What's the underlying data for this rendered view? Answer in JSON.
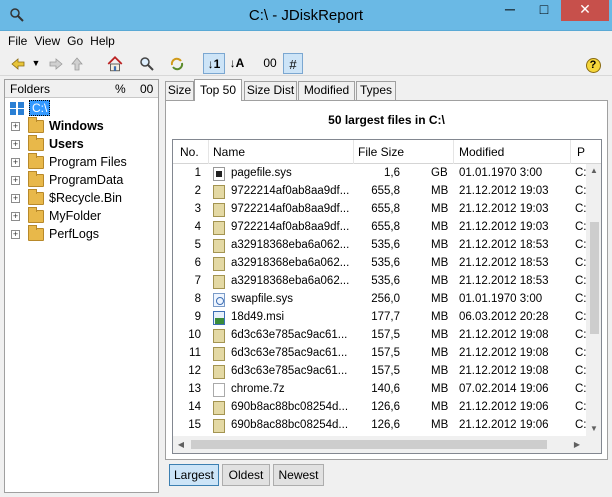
{
  "window": {
    "title": "C:\\ - JDiskReport",
    "minimize_glyph": "─",
    "maximize_glyph": "□",
    "close_glyph": "✕"
  },
  "menu": [
    "File",
    "View",
    "Go",
    "Help"
  ],
  "toolbar": {
    "back_icon": "arrow-left-icon",
    "forward_icon": "arrow-right-icon",
    "up_icon": "arrow-up-icon",
    "home_icon": "home-icon",
    "search_icon": "magnifier-icon",
    "refresh_icon": "refresh-icon",
    "sort_size_label": "↓1",
    "sort_name_label": "↓A",
    "show_size_label": "00",
    "show_count_label": "#",
    "help_label": "?"
  },
  "folders_panel": {
    "header": "Folders",
    "pct_label": "%",
    "count_label": "00",
    "root": "C:\\",
    "items": [
      {
        "name": "Windows",
        "bold": true
      },
      {
        "name": "Users",
        "bold": true
      },
      {
        "name": "Program Files",
        "bold": false
      },
      {
        "name": "ProgramData",
        "bold": false
      },
      {
        "name": "$Recycle.Bin",
        "bold": false
      },
      {
        "name": "MyFolder",
        "bold": false
      },
      {
        "name": "PerfLogs",
        "bold": false
      }
    ]
  },
  "tabs": [
    {
      "label": "Size",
      "active": false
    },
    {
      "label": "Top 50",
      "active": true
    },
    {
      "label": "Size Dist",
      "active": false
    },
    {
      "label": "Modified",
      "active": false
    },
    {
      "label": "Types",
      "active": false
    }
  ],
  "content": {
    "caption": "50 largest files in C:\\",
    "columns": [
      "No.",
      "Name",
      "File Size",
      "Modified",
      "P"
    ],
    "rows": [
      {
        "no": "1",
        "icon": "sys",
        "name": "pagefile.sys",
        "size": "1,6",
        "unit": "GB",
        "modified": "01.01.1970 3:00",
        "extra": "C:"
      },
      {
        "no": "2",
        "icon": "db",
        "name": "9722214af0ab8aa9df...",
        "size": "655,8",
        "unit": "MB",
        "modified": "21.12.2012 19:03",
        "extra": "C:"
      },
      {
        "no": "3",
        "icon": "db",
        "name": "9722214af0ab8aa9df...",
        "size": "655,8",
        "unit": "MB",
        "modified": "21.12.2012 19:03",
        "extra": "C:"
      },
      {
        "no": "4",
        "icon": "db",
        "name": "9722214af0ab8aa9df...",
        "size": "655,8",
        "unit": "MB",
        "modified": "21.12.2012 19:03",
        "extra": "C:"
      },
      {
        "no": "5",
        "icon": "db",
        "name": "a32918368eba6a062...",
        "size": "535,6",
        "unit": "MB",
        "modified": "21.12.2012 18:53",
        "extra": "C:"
      },
      {
        "no": "6",
        "icon": "db",
        "name": "a32918368eba6a062...",
        "size": "535,6",
        "unit": "MB",
        "modified": "21.12.2012 18:53",
        "extra": "C:"
      },
      {
        "no": "7",
        "icon": "db",
        "name": "a32918368eba6a062...",
        "size": "535,6",
        "unit": "MB",
        "modified": "21.12.2012 18:53",
        "extra": "C:"
      },
      {
        "no": "8",
        "icon": "swap",
        "name": "swapfile.sys",
        "size": "256,0",
        "unit": "MB",
        "modified": "01.01.1970 3:00",
        "extra": "C:"
      },
      {
        "no": "9",
        "icon": "msi",
        "name": "18d49.msi",
        "size": "177,7",
        "unit": "MB",
        "modified": "06.03.2012 20:28",
        "extra": "C:"
      },
      {
        "no": "10",
        "icon": "db",
        "name": "6d3c63e785ac9ac61...",
        "size": "157,5",
        "unit": "MB",
        "modified": "21.12.2012 19:08",
        "extra": "C:"
      },
      {
        "no": "11",
        "icon": "db",
        "name": "6d3c63e785ac9ac61...",
        "size": "157,5",
        "unit": "MB",
        "modified": "21.12.2012 19:08",
        "extra": "C:"
      },
      {
        "no": "12",
        "icon": "db",
        "name": "6d3c63e785ac9ac61...",
        "size": "157,5",
        "unit": "MB",
        "modified": "21.12.2012 19:08",
        "extra": "C:"
      },
      {
        "no": "13",
        "icon": "blank",
        "name": "chrome.7z",
        "size": "140,6",
        "unit": "MB",
        "modified": "07.02.2014 19:06",
        "extra": "C:"
      },
      {
        "no": "14",
        "icon": "db",
        "name": "690b8ac88bc08254d...",
        "size": "126,6",
        "unit": "MB",
        "modified": "21.12.2012 19:06",
        "extra": "C:"
      },
      {
        "no": "15",
        "icon": "db",
        "name": "690b8ac88bc08254d...",
        "size": "126,6",
        "unit": "MB",
        "modified": "21.12.2012 19:06",
        "extra": "C:"
      },
      {
        "no": "16",
        "icon": "db",
        "name": "690b8ac88bc08254d...",
        "size": "126,6",
        "unit": "MB",
        "modified": "21.12.2012 19:06",
        "extra": "C:"
      }
    ]
  },
  "bottom_buttons": [
    {
      "label": "Largest",
      "active": true
    },
    {
      "label": "Oldest",
      "active": false
    },
    {
      "label": "Newest",
      "active": false
    }
  ]
}
